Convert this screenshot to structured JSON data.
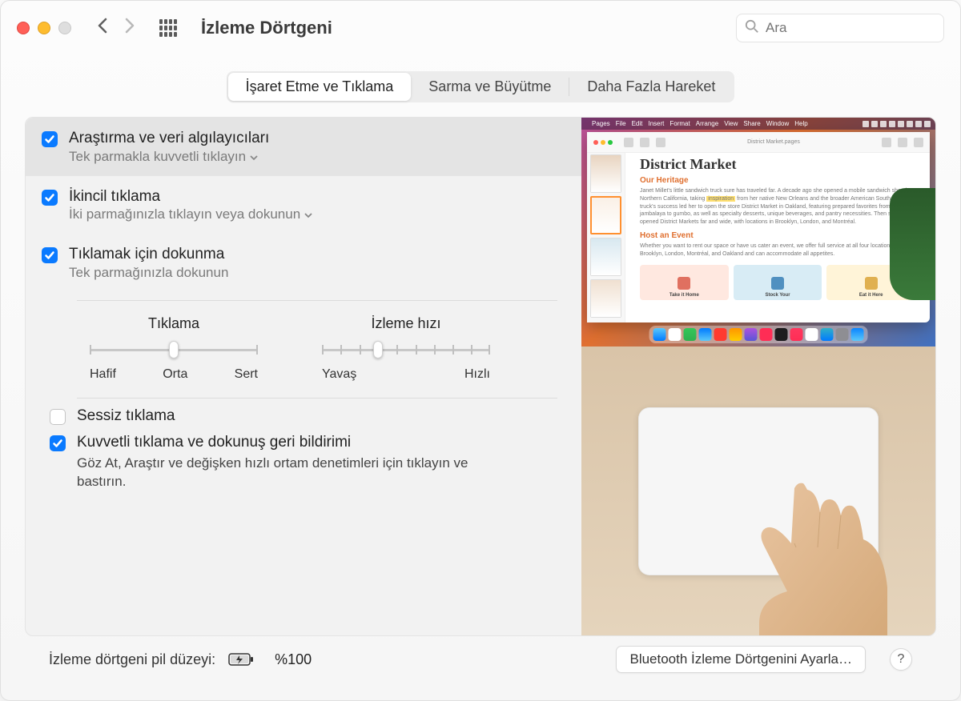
{
  "window": {
    "title": "İzleme Dörtgeni"
  },
  "search": {
    "placeholder": "Ara"
  },
  "tabs": {
    "point_click": "İşaret Etme ve Tıklama",
    "scroll_zoom": "Sarma ve Büyütme",
    "more_gestures": "Daha Fazla Hareket"
  },
  "options": {
    "lookup": {
      "title": "Araştırma ve veri algılayıcıları",
      "sub": "Tek parmakla kuvvetli tıklayın"
    },
    "secondary": {
      "title": "İkincil tıklama",
      "sub": "İki parmağınızla tıklayın veya dokunun"
    },
    "tap_click": {
      "title": "Tıklamak için dokunma",
      "sub": "Tek parmağınızla dokunun"
    },
    "silent": {
      "label": "Sessiz tıklama"
    },
    "force": {
      "label": "Kuvvetli tıklama ve dokunuş geri bildirimi",
      "desc": "Göz At, Araştır ve değişken hızlı ortam denetimleri için tıklayın ve bastırın."
    }
  },
  "sliders": {
    "click": {
      "label": "Tıklama",
      "min": "Hafif",
      "mid": "Orta",
      "max": "Sert"
    },
    "track": {
      "label": "İzleme hızı",
      "min": "Yavaş",
      "max": "Hızlı"
    }
  },
  "preview": {
    "doc_title": "District Market",
    "heritage": "Our Heritage",
    "host": "Host an Event",
    "body1": "Janet Millet's little sandwich truck sure has traveled far. A decade ago she opened a mobile sandwich shop in Northern California, taking",
    "hl": "inspiration",
    "body2": "from her native New Orleans and the broader American South. The truck's success led her to open the store District Market in Oakland, featuring prepared favorites from jambalaya to gumbo, as well as specialty desserts, unique beverages, and pantry necessities. Then she opened District Markets far and wide, with locations in Brooklyn, London, and Montréal.",
    "body3": "Whether you want to rent our space or have us cater an event, we offer full service at all four locations: Brooklyn, London, Montréal, and Oakland and can accommodate all appetites.",
    "c1": "Take it Home",
    "c2": "Stock Your",
    "c3": "Eat it Here",
    "filename": "District Market.pages"
  },
  "footer": {
    "battery_label": "İzleme dörtgeni pil düzeyi:",
    "battery_value": "%100",
    "bt_button": "Bluetooth İzleme Dörtgenini Ayarla…",
    "help": "?"
  }
}
